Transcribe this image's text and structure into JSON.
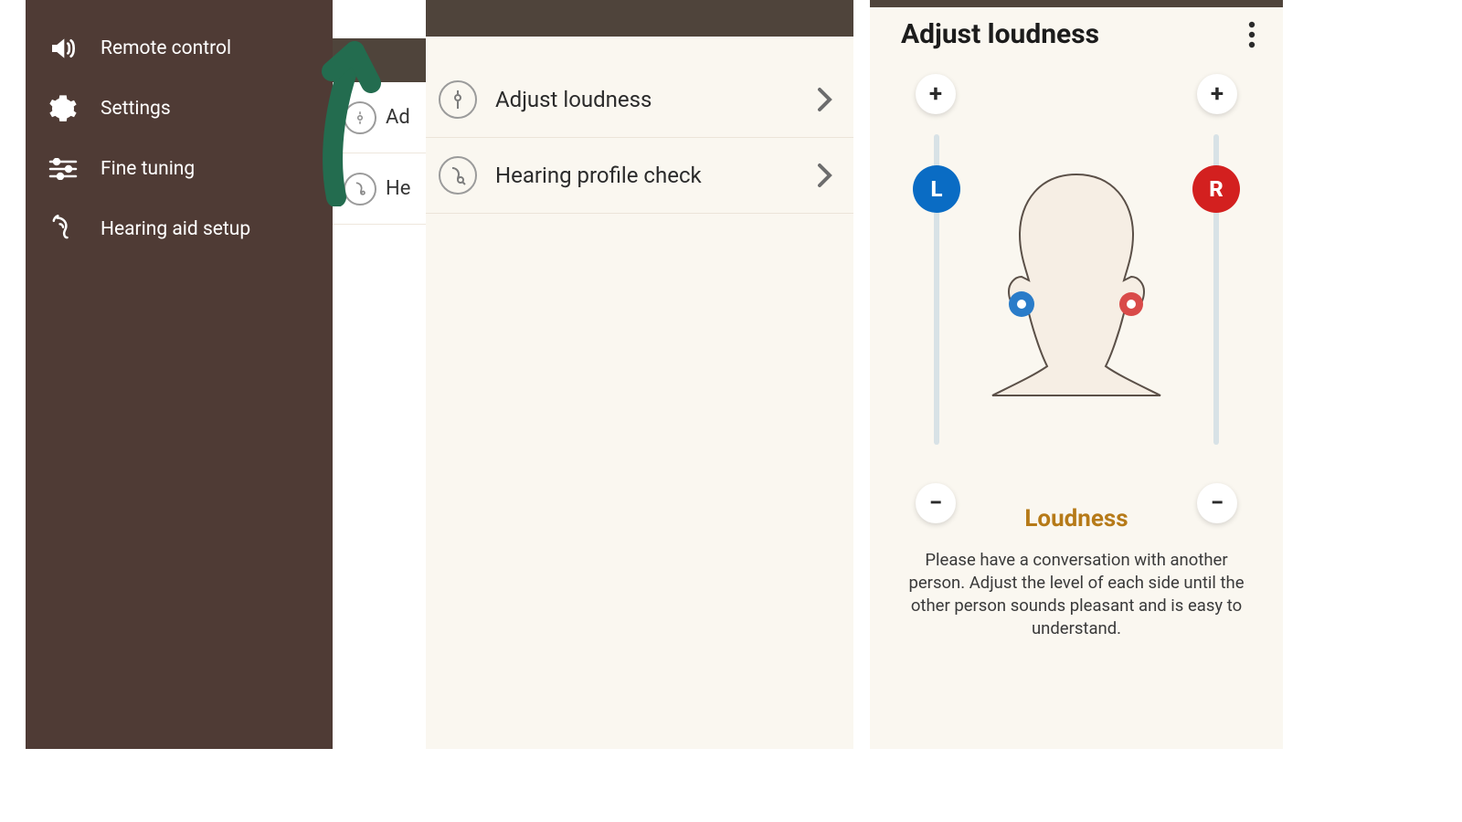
{
  "drawer": {
    "items": [
      {
        "label": "Remote control",
        "icon": "speaker-icon"
      },
      {
        "label": "Settings",
        "icon": "gear-icon"
      },
      {
        "label": "Fine tuning",
        "icon": "sliders-icon"
      },
      {
        "label": "Hearing aid setup",
        "icon": "ear-icon"
      }
    ]
  },
  "peek": {
    "rows": [
      {
        "label_prefix": "Ad",
        "icon": "gauge-icon"
      },
      {
        "label_prefix": "He",
        "icon": "ear-profile-icon"
      }
    ]
  },
  "list": {
    "rows": [
      {
        "label": "Adjust loudness",
        "icon": "gauge-icon"
      },
      {
        "label": "Hearing profile check",
        "icon": "ear-profile-icon"
      }
    ]
  },
  "adjust": {
    "title": "Adjust loudness",
    "left_letter": "L",
    "right_letter": "R",
    "plus": "+",
    "minus": "−",
    "section_label": "Loudness",
    "instruction": "Please have a conversation with another person. Adjust the level of each side until the other person sounds pleasant and is easy to understand.",
    "colors": {
      "left": "#0a6cc4",
      "right": "#d3201f",
      "accent": "#b67a18"
    },
    "slider": {
      "left_percent": 82,
      "right_percent": 82
    }
  }
}
